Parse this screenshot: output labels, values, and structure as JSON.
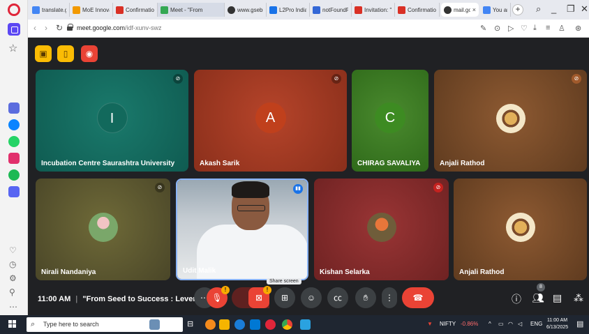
{
  "browser": {
    "tabs": [
      {
        "label": "translate.go",
        "fav_color": "#4285f4"
      },
      {
        "label": "MoE Innova",
        "fav_color": "#f29900"
      },
      {
        "label": "Confirmatio",
        "fav_color": "#d93025"
      },
      {
        "label": "Meet - \"From",
        "fav_color": "#34a853",
        "active": true
      },
      {
        "label": "www.gsebe",
        "fav_color": "#333333"
      },
      {
        "label": "L2Pro India",
        "fav_color": "#1a73e8"
      },
      {
        "label": "notFoundPa",
        "fav_color": "#3367d6"
      },
      {
        "label": "Invitation: \"I",
        "fav_color": "#d93025"
      },
      {
        "label": "Confirmatio",
        "fav_color": "#d93025"
      },
      {
        "label": "mail.goo",
        "fav_color": "#333333"
      },
      {
        "label": "You are sign",
        "fav_color": "#4285f4"
      }
    ],
    "new_tab": "+",
    "url_host": "meet.google.com",
    "url_path": "/idf-xunv-swz"
  },
  "meet": {
    "top_buttons": [
      {
        "name": "hand-raise-off-icon",
        "glyph": "▣",
        "color": "#fbbc04"
      },
      {
        "name": "door-icon",
        "glyph": "▯",
        "color": "#fbbc04"
      },
      {
        "name": "record-icon",
        "glyph": "◉",
        "color": "#ea4335"
      }
    ],
    "participants": [
      {
        "name": "Incubation Centre Saurashtra University",
        "initial": "I",
        "bg": "#12695c",
        "avatar": "#12695c",
        "muted": true
      },
      {
        "name": "Akash Sarik",
        "initial": "A",
        "bg": "#a23b1f",
        "avatar": "#c0401c",
        "muted": true
      },
      {
        "name": "CHIRAG SAVALIYA",
        "initial": "C",
        "bg": "#3d7a22",
        "avatar": "#3d8b22",
        "muted": false
      },
      {
        "name": "Anjali Rathod",
        "initial": "",
        "bg": "#7a4a28",
        "muted": true
      },
      {
        "name": "Nirali Nandaniya",
        "initial": "",
        "bg": "#5e5a2e",
        "muted": true
      },
      {
        "name": "Udit Malik",
        "initial": "",
        "bg": "#9aa8b3",
        "muted": false
      },
      {
        "name": "Kishan Selarka",
        "initial": "",
        "bg": "#8a2e2e",
        "muted": true
      },
      {
        "name": "Anjali Rathod",
        "initial": "",
        "bg": "#7a4a28",
        "muted": false
      }
    ],
    "meeting_time": "11:00 AM",
    "separator": "|",
    "meeting_title": "\"From Seed to Success : Lever...",
    "share_tooltip": "Share screen",
    "participant_count": "8",
    "badge_warning": "!"
  },
  "taskbar": {
    "search_placeholder": "Type here to search",
    "stock_label": "NIFTY",
    "stock_change": "-0.86%",
    "lang": "ENG",
    "clock_time": "11:00 AM",
    "clock_date": "6/13/2025"
  }
}
